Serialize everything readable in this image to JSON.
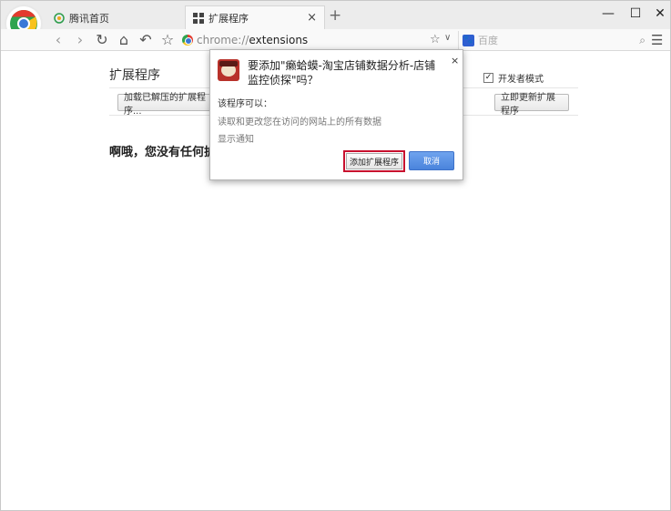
{
  "tabs": [
    {
      "label": "腾讯首页",
      "icon": "tencent-icon"
    },
    {
      "label": "扩展程序",
      "icon": "extensions-grid-icon"
    }
  ],
  "new_tab_symbol": "+",
  "tab_close_symbol": "×",
  "window_controls": {
    "minimize": "—",
    "maximize": "☐",
    "close": "✕"
  },
  "toolbar": {
    "url_scheme": "chrome://",
    "url_path": "extensions",
    "search_placeholder": "百度",
    "search_engine_icon": "baidu-icon"
  },
  "page": {
    "title": "扩展程序",
    "developer_mode_label": "开发者模式",
    "developer_mode_checked": true,
    "load_unpacked_label": "加载已解压的扩展程序...",
    "update_now_label": "立即更新扩展程序",
    "empty_message": "啊哦，您没有任何扩展"
  },
  "dialog": {
    "title": "要添加\"癞蛤蟆-淘宝店铺数据分析-店铺监控侦探\"吗？",
    "subtitle": "该程序可以：",
    "permissions": [
      "读取和更改您在访问的网站上的所有数据",
      "显示通知"
    ],
    "add_label": "添加扩展程序",
    "cancel_label": "取消",
    "close_symbol": "×"
  },
  "colors": {
    "highlight_border": "#c8102e",
    "cancel_button": "#4a84dc"
  }
}
